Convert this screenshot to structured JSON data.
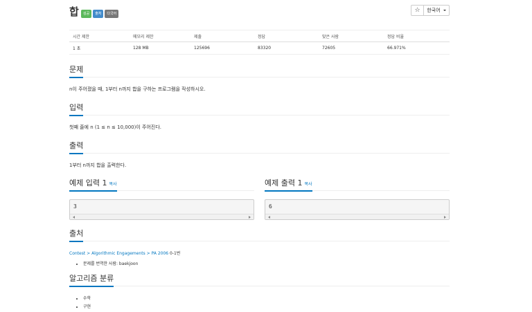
{
  "problem": {
    "title": "합",
    "labels": [
      {
        "text": "성공",
        "color": "#5cb85c"
      },
      {
        "text": "출처",
        "color": "#428bca"
      },
      {
        "text": "다국어",
        "color": "#777777"
      }
    ]
  },
  "toolbar": {
    "star_icon": "star-icon",
    "language": "한국어"
  },
  "stats": {
    "headers": [
      "시간 제한",
      "메모리 제한",
      "제출",
      "정답",
      "맞은 사람",
      "정답 비율"
    ],
    "values": [
      "1 초",
      "128 MB",
      "125696",
      "83320",
      "72605",
      "66.971%"
    ]
  },
  "sections": {
    "description": {
      "title": "문제",
      "text": "n이 주어졌을 때, 1부터 n까지 합을 구하는 프로그램을 작성하시오."
    },
    "input": {
      "title": "입력",
      "text": "첫째 줄에 n (1 ≤ n ≤ 10,000)이 주어진다."
    },
    "output": {
      "title": "출력",
      "text": "1부터 n까지 합을 출력한다."
    }
  },
  "samples": {
    "input": {
      "title": "예제 입력 1",
      "copy": "복사",
      "value": "3"
    },
    "output": {
      "title": "예제 출력 1",
      "copy": "복사",
      "value": "6"
    }
  },
  "source": {
    "title": "출처",
    "crumbs": [
      "Contest",
      ">",
      "Algorithmic Engagements",
      ">",
      "PA 2006"
    ],
    "suffix": "0-1번",
    "bullets": [
      "문제를 번역한 사람: baekjoon"
    ]
  },
  "tags": {
    "title": "알고리즘 분류",
    "items": [
      "수학",
      "구현"
    ]
  }
}
